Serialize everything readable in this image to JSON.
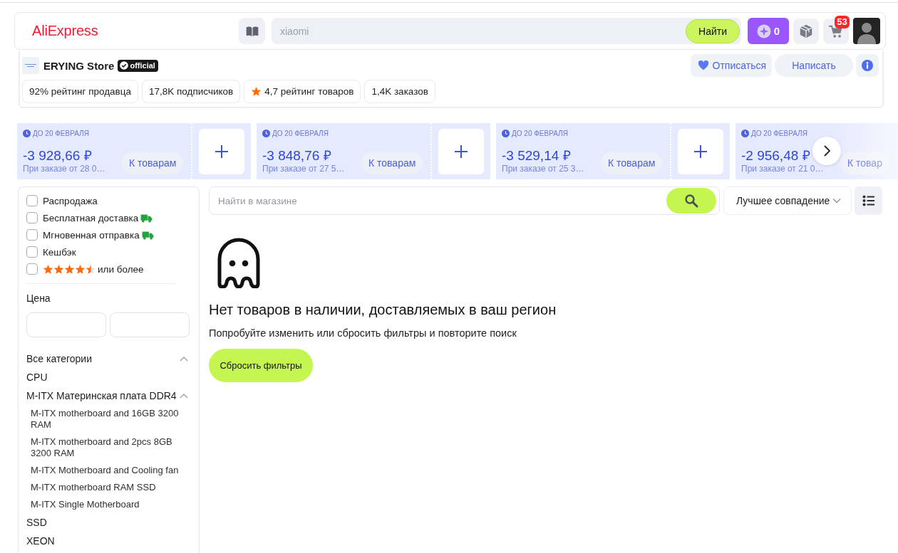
{
  "header": {
    "logo": "AliExpress",
    "search": {
      "placeholder": "xiaomi",
      "button": "Найти"
    },
    "coins": "0",
    "cart_count": "53"
  },
  "store": {
    "name": "ERYING Store",
    "badge": "official",
    "actions": [
      {
        "kind": "unsubscribe",
        "label": "Отписаться"
      },
      {
        "kind": "message",
        "label": "Написать"
      },
      {
        "kind": "info"
      }
    ],
    "stats": [
      {
        "kind": "text",
        "text": "92% рейтинг продавца"
      },
      {
        "kind": "text",
        "text": "17,8K подписчиков"
      },
      {
        "kind": "rating",
        "text": "4,7 рейтинг товаров"
      },
      {
        "kind": "text",
        "text": "1,4K заказов"
      }
    ]
  },
  "coupons": [
    {
      "deadline": "ДО 20 ФЕВРАЛЯ",
      "amount": "-3 928,66 ₽",
      "condition": "При заказе от 28 0…",
      "button": "К товарам"
    },
    {
      "deadline": "ДО 20 ФЕВРАЛЯ",
      "amount": "-3 848,76 ₽",
      "condition": "При заказе от 27 5…",
      "button": "К товарам"
    },
    {
      "deadline": "ДО 20 ФЕВРАЛЯ",
      "amount": "-3 529,14 ₽",
      "condition": "При заказе от 25 3…",
      "button": "К товарам"
    },
    {
      "deadline": "ДО 20 ФЕВРАЛЯ",
      "amount": "-2 956,48 ₽",
      "condition": "При заказе от 21 0…",
      "button": "К товар"
    }
  ],
  "filters": [
    {
      "kind": "plain",
      "label": "Распродажа",
      "checked": false
    },
    {
      "kind": "truck",
      "label": "Бесплатная доставка",
      "checked": false
    },
    {
      "kind": "truck",
      "label": "Мгновенная отправка",
      "checked": false
    },
    {
      "kind": "plain",
      "label": "Кешбэк",
      "checked": false
    },
    {
      "kind": "rating",
      "stars": 4.5,
      "label": "или более",
      "checked": false
    }
  ],
  "price": {
    "title": "Цена"
  },
  "categories": {
    "label": "Все категории",
    "expanded": true,
    "children": [
      {
        "label": "CPU"
      },
      {
        "label": "M-ITX Материнская плата DDR4",
        "expanded": true,
        "children": [
          {
            "label": "M-ITX motherboard and 16GB 3200 RAM"
          },
          {
            "label": "M-ITX motherboard and 2pcs 8GB 3200 RAM"
          },
          {
            "label": "M-ITX Motherboard and Cooling fan"
          },
          {
            "label": "M-ITX motherboard RAM SSD"
          },
          {
            "label": "M-ITX Single Motherboard"
          }
        ]
      },
      {
        "label": "SSD"
      },
      {
        "label": "XEON"
      }
    ]
  },
  "shop_search": {
    "placeholder": "Найти в магазине"
  },
  "sort": {
    "value": "Лучшее совпадение"
  },
  "empty_state": {
    "title": "Нет товаров в наличии, доставляемых в ваш регион",
    "text": "Попробуйте изменить или сбросить фильтры и повторите поиск",
    "button": "Сбросить фильтры"
  }
}
